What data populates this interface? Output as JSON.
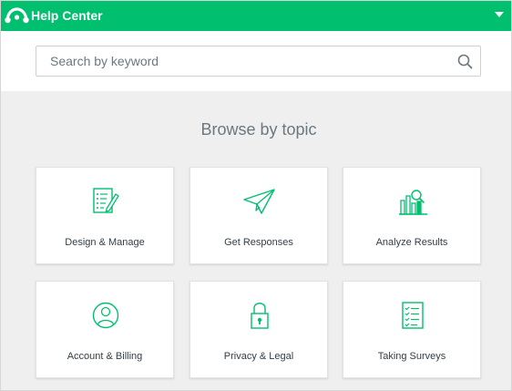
{
  "header": {
    "title": "Help Center",
    "brand_color": "#00bf6f"
  },
  "search": {
    "placeholder": "Search by keyword",
    "value": ""
  },
  "browse": {
    "title": "Browse by topic",
    "icon_color": "#00bf6f",
    "topics": [
      {
        "label": "Design & Manage",
        "icon": "survey-edit-icon"
      },
      {
        "label": "Get Responses",
        "icon": "paper-plane-icon"
      },
      {
        "label": "Analyze Results",
        "icon": "chart-magnifier-icon"
      },
      {
        "label": "Account & Billing",
        "icon": "user-circle-icon"
      },
      {
        "label": "Privacy & Legal",
        "icon": "padlock-icon"
      },
      {
        "label": "Taking Surveys",
        "icon": "checklist-icon"
      }
    ]
  }
}
